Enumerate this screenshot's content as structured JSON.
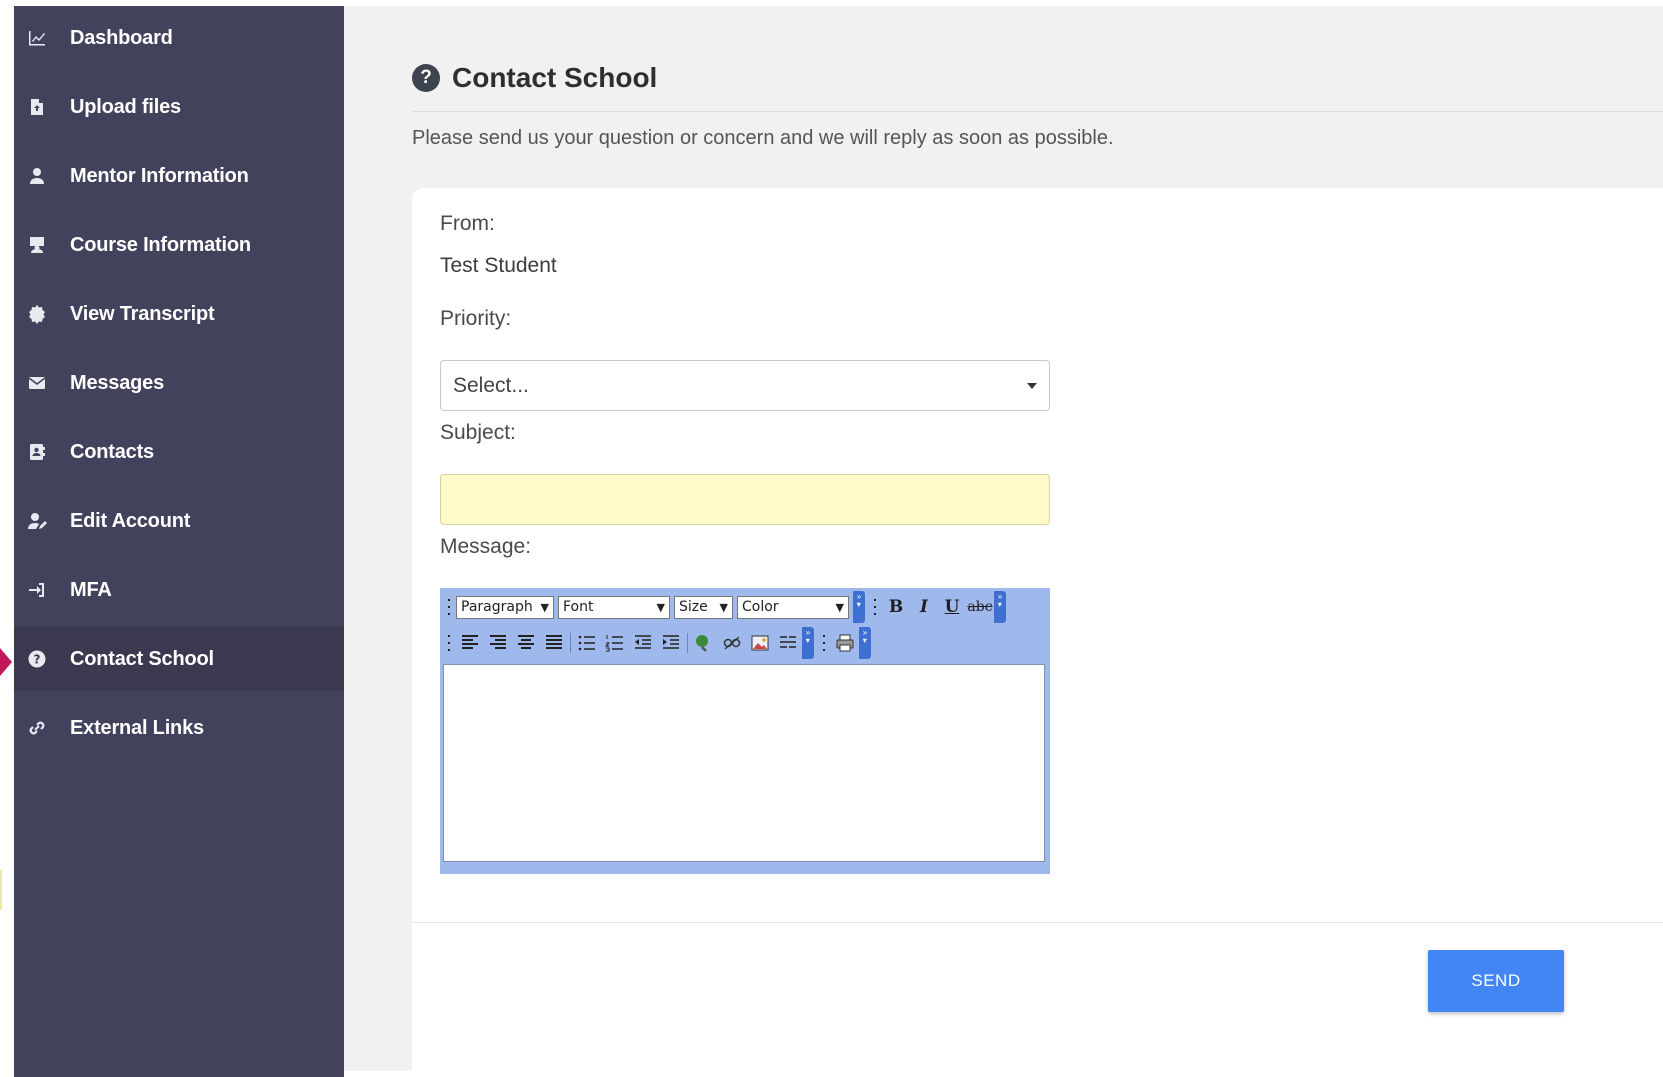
{
  "sidebar": {
    "items": [
      {
        "label": "Dashboard",
        "icon": "chart-line-icon"
      },
      {
        "label": "Upload files",
        "icon": "file-upload-icon"
      },
      {
        "label": "Mentor Information",
        "icon": "user-tie-icon"
      },
      {
        "label": "Course Information",
        "icon": "chalkboard-teacher-icon"
      },
      {
        "label": "View Transcript",
        "icon": "certificate-icon"
      },
      {
        "label": "Messages",
        "icon": "envelope-icon"
      },
      {
        "label": "Contacts",
        "icon": "address-book-icon"
      },
      {
        "label": "Edit Account",
        "icon": "user-edit-icon"
      },
      {
        "label": "MFA",
        "icon": "sign-in-icon"
      },
      {
        "label": "Contact School",
        "icon": "question-circle-icon",
        "active": true
      },
      {
        "label": "External Links",
        "icon": "link-icon"
      }
    ]
  },
  "header": {
    "title": "Contact School",
    "title_icon": "question-circle-icon",
    "subtitle": "Please send us your question or concern and we will reply as soon as possible."
  },
  "form": {
    "from_label": "From:",
    "from_value": "Test Student",
    "priority_label": "Priority:",
    "priority_value": "Select...",
    "subject_label": "Subject:",
    "subject_value": "",
    "message_label": "Message:"
  },
  "editor": {
    "paragraph": "Paragraph",
    "font": "Font",
    "size": "Size",
    "color": "Color",
    "bold": "B",
    "italic": "I",
    "underline": "U",
    "strike": "abc"
  },
  "actions": {
    "send_label": "SEND"
  },
  "colors": {
    "sidebar_bg": "#43425d",
    "sidebar_active": "#3a394f",
    "send_button": "#4285f4",
    "subject_bg": "#fefbc8",
    "editor_toolbar": "#9fb9ec"
  }
}
